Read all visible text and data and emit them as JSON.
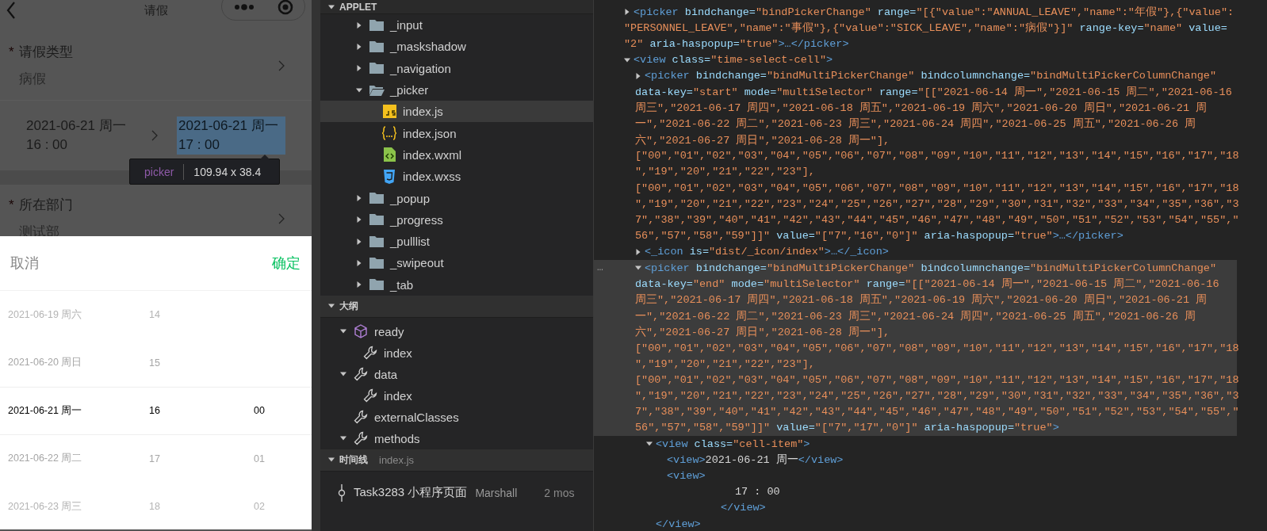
{
  "simulator": {
    "title": "请假",
    "form": [
      {
        "kind": "select",
        "required_mark": "*",
        "label": "请假类型",
        "value": "病假"
      },
      {
        "kind": "time-range",
        "start": {
          "date": "2021-06-21 周一",
          "time": "16 : 00",
          "inspected": false
        },
        "end": {
          "date": "2021-06-21 周一",
          "time": "17 : 00",
          "inspected": true
        }
      },
      {
        "kind": "select",
        "required_mark": "*",
        "label": "所在部门",
        "value": "测试部"
      }
    ],
    "inspector_tooltip": {
      "tag": "picker",
      "size": "109.94 x 38.4"
    },
    "picker": {
      "cancel": "取消",
      "confirm": "确定",
      "rows": [
        {
          "date": "2021-06-19 周六",
          "hour": "14",
          "selected": false
        },
        {
          "date": "2021-06-20 周日",
          "hour": "15",
          "selected": false
        },
        {
          "date": "2021-06-21 周一",
          "hour": "16",
          "minute": "00",
          "selected": true
        },
        {
          "date": "2021-06-22 周二",
          "hour": "17",
          "minute": "01",
          "selected": false
        },
        {
          "date": "2021-06-23 周三",
          "hour": "18",
          "minute": "02",
          "selected": false
        }
      ]
    }
  },
  "explorer": {
    "title": "APPLET",
    "items": [
      {
        "kind": "folder",
        "label": "_input",
        "expanded": false
      },
      {
        "kind": "folder",
        "label": "_maskshadow",
        "expanded": false
      },
      {
        "kind": "folder",
        "label": "_navigation",
        "expanded": false
      },
      {
        "kind": "folder",
        "label": "_picker",
        "expanded": true,
        "children": [
          {
            "kind": "js",
            "label": "index.js",
            "selected": true
          },
          {
            "kind": "json",
            "label": "index.json",
            "selected": false
          },
          {
            "kind": "wxml",
            "label": "index.wxml",
            "selected": false
          },
          {
            "kind": "wxss",
            "label": "index.wxss",
            "selected": false
          }
        ]
      },
      {
        "kind": "folder",
        "label": "_popup",
        "expanded": false
      },
      {
        "kind": "folder",
        "label": "_progress",
        "expanded": false
      },
      {
        "kind": "folder",
        "label": "_pulllist",
        "expanded": false
      },
      {
        "kind": "folder",
        "label": "_swipeout",
        "expanded": false
      },
      {
        "kind": "folder",
        "label": "_tab",
        "expanded": false
      }
    ]
  },
  "outline": {
    "title": "大纲",
    "items": [
      {
        "kind": "method",
        "label": "ready",
        "expanded": true,
        "children": [
          {
            "kind": "property",
            "label": "index"
          }
        ]
      },
      {
        "kind": "property",
        "label": "data",
        "expanded": true,
        "children": [
          {
            "kind": "property",
            "label": "index"
          }
        ]
      },
      {
        "kind": "property",
        "label": "externalClasses"
      },
      {
        "kind": "property",
        "label": "methods",
        "expanded": true
      }
    ]
  },
  "timeline": {
    "title": "时间线",
    "file": "index.js",
    "items": [
      {
        "message": "Task3283 小程序页面",
        "author": "Marshall",
        "age": "2 mos"
      }
    ]
  },
  "elements": {
    "nodes": [
      {
        "kind": "element",
        "expanded": false,
        "lines": [
          [
            {
              "kind": "tag",
              "text": "<picker"
            },
            {
              "kind": "attr",
              "text": " bindchange="
            },
            {
              "kind": "value",
              "text": "\"bindPickerChange\""
            },
            {
              "kind": "attr",
              "text": " range="
            },
            {
              "kind": "value",
              "text": "\"[{\"value\":\"ANNUAL_LEAVE\",\"name\":\"年假\"},{\"value\":"
            }
          ],
          [
            {
              "kind": "value",
              "text": "\"PERSONNEL_LEAVE\",\"name\":\"事假\"},{\"value\":\"SICK_LEAVE\",\"name\":\"病假\"}]\""
            },
            {
              "kind": "attr",
              "text": " range-key="
            },
            {
              "kind": "value",
              "text": "\"name\""
            },
            {
              "kind": "attr",
              "text": " value="
            }
          ],
          [
            {
              "kind": "value",
              "text": "\"2\""
            },
            {
              "kind": "attr",
              "text": " aria-haspopup="
            },
            {
              "kind": "value",
              "text": "\"true\""
            },
            {
              "kind": "tag",
              "text": ">…</picker>"
            }
          ]
        ]
      },
      {
        "kind": "element",
        "expanded": true,
        "lines": [
          [
            {
              "kind": "tag",
              "text": "<view"
            },
            {
              "kind": "attr",
              "text": " class="
            },
            {
              "kind": "value",
              "text": "\"time-select-cell\""
            },
            {
              "kind": "tag",
              "text": ">"
            }
          ]
        ],
        "children": [
          {
            "kind": "element",
            "expanded": false,
            "lines": [
              [
                {
                  "kind": "tag",
                  "text": "<picker"
                },
                {
                  "kind": "attr",
                  "text": " bindchange="
                },
                {
                  "kind": "value",
                  "text": "\"bindMultiPickerChange\""
                },
                {
                  "kind": "attr",
                  "text": " bindcolumnchange="
                },
                {
                  "kind": "value",
                  "text": "\"bindMultiPickerColumnChange\""
                }
              ],
              [
                {
                  "kind": "attr",
                  "text": "data-key="
                },
                {
                  "kind": "value",
                  "text": "\"start\""
                },
                {
                  "kind": "attr",
                  "text": " mode="
                },
                {
                  "kind": "value",
                  "text": "\"multiSelector\""
                },
                {
                  "kind": "attr",
                  "text": " range="
                },
                {
                  "kind": "value",
                  "text": "\"[[\"2021-06-14 周一\",\"2021-06-15 周二\",\"2021-06-16"
                }
              ],
              [
                {
                  "kind": "value",
                  "text": "周三\",\"2021-06-17 周四\",\"2021-06-18 周五\",\"2021-06-19 周六\",\"2021-06-20 周日\",\"2021-06-21 周"
                }
              ],
              [
                {
                  "kind": "value",
                  "text": "一\",\"2021-06-22 周二\",\"2021-06-23 周三\",\"2021-06-24 周四\",\"2021-06-25 周五\",\"2021-06-26 周"
                }
              ],
              [
                {
                  "kind": "value",
                  "text": "六\",\"2021-06-27 周日\",\"2021-06-28 周一\"],"
                }
              ],
              [
                {
                  "kind": "value",
                  "text": "[\"00\",\"01\",\"02\",\"03\",\"04\",\"05\",\"06\",\"07\",\"08\",\"09\",\"10\",\"11\",\"12\",\"13\",\"14\",\"15\",\"16\",\"17\",\"18"
                }
              ],
              [
                {
                  "kind": "value",
                  "text": "\",\"19\",\"20\",\"21\",\"22\",\"23\"],"
                }
              ],
              [
                {
                  "kind": "value",
                  "text": "[\"00\",\"01\",\"02\",\"03\",\"04\",\"05\",\"06\",\"07\",\"08\",\"09\",\"10\",\"11\",\"12\",\"13\",\"14\",\"15\",\"16\",\"17\",\"18"
                }
              ],
              [
                {
                  "kind": "value",
                  "text": "\",\"19\",\"20\",\"21\",\"22\",\"23\",\"24\",\"25\",\"26\",\"27\",\"28\",\"29\",\"30\",\"31\",\"32\",\"33\",\"34\",\"35\",\"36\",\"3"
                }
              ],
              [
                {
                  "kind": "value",
                  "text": "7\",\"38\",\"39\",\"40\",\"41\",\"42\",\"43\",\"44\",\"45\",\"46\",\"47\",\"48\",\"49\",\"50\",\"51\",\"52\",\"53\",\"54\",\"55\",\""
                }
              ],
              [
                {
                  "kind": "value",
                  "text": "56\",\"57\",\"58\",\"59\"]]\""
                },
                {
                  "kind": "attr",
                  "text": " value="
                },
                {
                  "kind": "value",
                  "text": "\"[\"7\",\"16\",\"0\"]\""
                },
                {
                  "kind": "attr",
                  "text": " aria-haspopup="
                },
                {
                  "kind": "value",
                  "text": "\"true\""
                },
                {
                  "kind": "tag",
                  "text": ">…</picker>"
                }
              ]
            ]
          },
          {
            "kind": "element",
            "expanded": false,
            "lines": [
              [
                {
                  "kind": "tag",
                  "text": "<_icon"
                },
                {
                  "kind": "attr",
                  "text": " is="
                },
                {
                  "kind": "value",
                  "text": "\"dist/_icon/index\""
                },
                {
                  "kind": "tag",
                  "text": ">…</_icon>"
                }
              ]
            ]
          },
          {
            "kind": "element",
            "expanded": true,
            "selected": true,
            "more": "…",
            "lines": [
              [
                {
                  "kind": "tag",
                  "text": "<picker"
                },
                {
                  "kind": "attr",
                  "text": " bindchange="
                },
                {
                  "kind": "value",
                  "text": "\"bindMultiPickerChange\""
                },
                {
                  "kind": "attr",
                  "text": " bindcolumnchange="
                },
                {
                  "kind": "value",
                  "text": "\"bindMultiPickerColumnChange\""
                }
              ],
              [
                {
                  "kind": "attr",
                  "text": "data-key="
                },
                {
                  "kind": "value",
                  "text": "\"end\""
                },
                {
                  "kind": "attr",
                  "text": " mode="
                },
                {
                  "kind": "value",
                  "text": "\"multiSelector\""
                },
                {
                  "kind": "attr",
                  "text": " range="
                },
                {
                  "kind": "value",
                  "text": "\"[[\"2021-06-14 周一\",\"2021-06-15 周二\",\"2021-06-16"
                }
              ],
              [
                {
                  "kind": "value",
                  "text": "周三\",\"2021-06-17 周四\",\"2021-06-18 周五\",\"2021-06-19 周六\",\"2021-06-20 周日\",\"2021-06-21 周"
                }
              ],
              [
                {
                  "kind": "value",
                  "text": "一\",\"2021-06-22 周二\",\"2021-06-23 周三\",\"2021-06-24 周四\",\"2021-06-25 周五\",\"2021-06-26 周"
                }
              ],
              [
                {
                  "kind": "value",
                  "text": "六\",\"2021-06-27 周日\",\"2021-06-28 周一\"],"
                }
              ],
              [
                {
                  "kind": "value",
                  "text": "[\"00\",\"01\",\"02\",\"03\",\"04\",\"05\",\"06\",\"07\",\"08\",\"09\",\"10\",\"11\",\"12\",\"13\",\"14\",\"15\",\"16\",\"17\",\"18"
                }
              ],
              [
                {
                  "kind": "value",
                  "text": "\",\"19\",\"20\",\"21\",\"22\",\"23\"],"
                }
              ],
              [
                {
                  "kind": "value",
                  "text": "[\"00\",\"01\",\"02\",\"03\",\"04\",\"05\",\"06\",\"07\",\"08\",\"09\",\"10\",\"11\",\"12\",\"13\",\"14\",\"15\",\"16\",\"17\",\"18"
                }
              ],
              [
                {
                  "kind": "value",
                  "text": "\",\"19\",\"20\",\"21\",\"22\",\"23\",\"24\",\"25\",\"26\",\"27\",\"28\",\"29\",\"30\",\"31\",\"32\",\"33\",\"34\",\"35\",\"36\",\"3"
                }
              ],
              [
                {
                  "kind": "value",
                  "text": "7\",\"38\",\"39\",\"40\",\"41\",\"42\",\"43\",\"44\",\"45\",\"46\",\"47\",\"48\",\"49\",\"50\",\"51\",\"52\",\"53\",\"54\",\"55\",\""
                }
              ],
              [
                {
                  "kind": "value",
                  "text": "56\",\"57\",\"58\",\"59\"]]\""
                },
                {
                  "kind": "attr",
                  "text": " value="
                },
                {
                  "kind": "value",
                  "text": "\"[\"7\",\"17\",\"0\"]\""
                },
                {
                  "kind": "attr",
                  "text": " aria-haspopup="
                },
                {
                  "kind": "value",
                  "text": "\"true\""
                },
                {
                  "kind": "tag",
                  "text": ">"
                }
              ]
            ],
            "children": [
              {
                "kind": "element",
                "expanded": true,
                "lines": [
                  [
                    {
                      "kind": "tag",
                      "text": "<view"
                    },
                    {
                      "kind": "attr",
                      "text": " class="
                    },
                    {
                      "kind": "value",
                      "text": "\"cell-item\""
                    },
                    {
                      "kind": "tag",
                      "text": ">"
                    }
                  ]
                ],
                "children": [
                  {
                    "kind": "element",
                    "lines": [
                      [
                        {
                          "kind": "tag",
                          "text": "<view>"
                        },
                        {
                          "kind": "text",
                          "text": "2021-06-21 周一"
                        },
                        {
                          "kind": "tag",
                          "text": "</view>"
                        }
                      ]
                    ]
                  },
                  {
                    "kind": "element",
                    "lines": [
                      [
                        {
                          "kind": "tag",
                          "text": "<view>"
                        }
                      ]
                    ],
                    "children": [
                      {
                        "kind": "text",
                        "lines": [
                          [
                            {
                              "kind": "text",
                              "text": "17 : 00"
                            }
                          ]
                        ]
                      },
                      {
                        "kind": "pre",
                        "lines": [
                          [
                            {
                              "kind": "tag",
                              "text": "</view>"
                            }
                          ]
                        ]
                      }
                    ]
                  }
                ],
                "close": [
                  [
                    {
                      "kind": "tag",
                      "text": "</view>"
                    }
                  ]
                ]
              }
            ]
          }
        ]
      }
    ]
  }
}
